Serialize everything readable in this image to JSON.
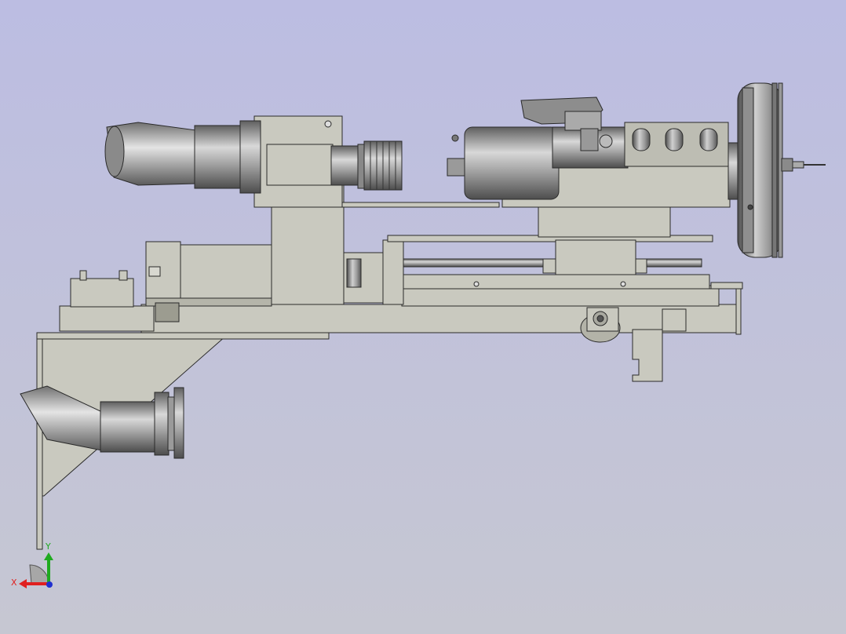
{
  "viewport": {
    "background_top": "#bcbde2",
    "background_bottom": "#c6c7d2"
  },
  "model": {
    "part_fill": "#c9c9bf",
    "part_shade": "#b6b6ab",
    "edge_color": "#2a2a2a",
    "metal_dark": "#6e6e6e",
    "metal_light": "#dcdcdc"
  },
  "triad": {
    "x_label": "X",
    "y_label": "Y",
    "x_color": "#e02020",
    "y_color": "#1faa1f",
    "z_color": "#2030d0"
  }
}
